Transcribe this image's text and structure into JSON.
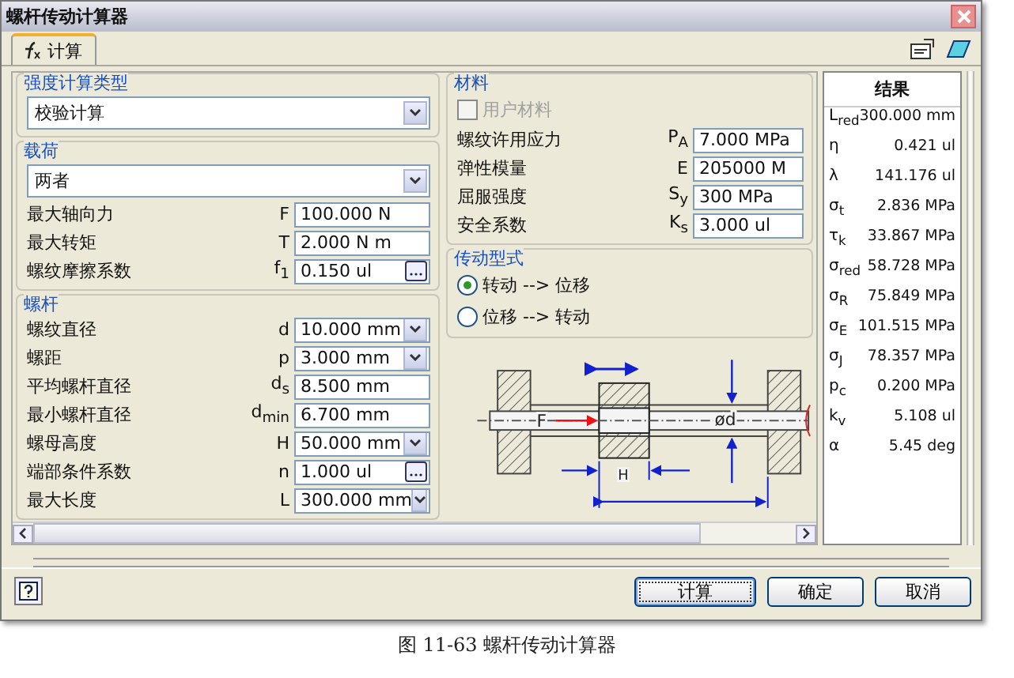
{
  "window": {
    "title": "螺杆传动计算器"
  },
  "tabs": [
    {
      "label": "计算",
      "selected": true
    }
  ],
  "strength_type": {
    "title": "强度计算类型",
    "value": "校验计算"
  },
  "loads": {
    "title": "载荷",
    "mode": "两者",
    "rows": [
      {
        "label": "最大轴向力",
        "symbol": "F",
        "value": "100.000 N",
        "kind": "plain"
      },
      {
        "label": "最大转矩",
        "symbol": "T",
        "value": "2.000 N m",
        "kind": "plain"
      },
      {
        "label": "螺纹摩擦系数",
        "symbol": "f$_{1}$",
        "value": "0.150 ul",
        "kind": "more"
      }
    ]
  },
  "screw": {
    "title": "螺杆",
    "rows": [
      {
        "label": "螺纹直径",
        "symbol": "d",
        "value": "10.000 mm",
        "kind": "dropdown"
      },
      {
        "label": "螺距",
        "symbol": "p",
        "value": "3.000 mm",
        "kind": "dropdown"
      },
      {
        "label": "平均螺杆直径",
        "symbol": "d$_{s}$",
        "value": "8.500 mm",
        "kind": "plain"
      },
      {
        "label": "最小螺杆直径",
        "symbol": "d$_{min}$",
        "value": "6.700 mm",
        "kind": "plain"
      },
      {
        "label": "螺母高度",
        "symbol": "H",
        "value": "50.000 mm",
        "kind": "dropdown"
      },
      {
        "label": "端部条件系数",
        "symbol": "n",
        "value": "1.000 ul",
        "kind": "more"
      },
      {
        "label": "最大长度",
        "symbol": "L",
        "value": "300.000 mm",
        "kind": "dropdown"
      }
    ]
  },
  "material": {
    "title": "材料",
    "user_material": {
      "label": "用户材料",
      "checked": false,
      "disabled": true
    },
    "rows": [
      {
        "label": "螺纹许用应力",
        "symbol": "P$_{A}$",
        "value": "7.000 MPa"
      },
      {
        "label": "弹性模量",
        "symbol": "E",
        "value": "205000 M"
      },
      {
        "label": "屈服强度",
        "symbol": "S$_{y}$",
        "value": "300 MPa"
      },
      {
        "label": "安全系数",
        "symbol": "K$_{s}$",
        "value": "3.000 ul"
      }
    ]
  },
  "transmission": {
    "title": "传动型式",
    "options": [
      {
        "label": "转动 --> 位移",
        "selected": true
      },
      {
        "label": "位移 --> 转动",
        "selected": false
      }
    ]
  },
  "diagram": {
    "force_label": "F",
    "diameter_label": "ød",
    "height_label": "H"
  },
  "results": {
    "title": "结果",
    "rows": [
      {
        "symbol": "L$_{red}$",
        "value": "300.000 mm"
      },
      {
        "symbol": "η",
        "value": "0.421 ul"
      },
      {
        "symbol": "λ",
        "value": "141.176 ul"
      },
      {
        "symbol": "σ$_{t}$",
        "value": "2.836 MPa"
      },
      {
        "symbol": "τ$_{k}$",
        "value": "33.867 MPa"
      },
      {
        "symbol": "σ$_{red}$",
        "value": "58.728 MPa"
      },
      {
        "symbol": "σ$_{R}$",
        "value": "75.849 MPa"
      },
      {
        "symbol": "σ$_{E}$",
        "value": "101.515 MPa"
      },
      {
        "symbol": "σ$_{J}$",
        "value": "78.357 MPa"
      },
      {
        "symbol": "p$_{c}$",
        "value": "0.200 MPa"
      },
      {
        "symbol": "k$_{v}$",
        "value": "5.108 ul"
      },
      {
        "symbol": "α",
        "value": "5.45 deg"
      }
    ]
  },
  "buttons": [
    {
      "label": "计算",
      "default": true
    },
    {
      "label": "确定",
      "default": false
    },
    {
      "label": "取消",
      "default": false
    }
  ],
  "caption": "图 11-63 螺杆传动计算器"
}
